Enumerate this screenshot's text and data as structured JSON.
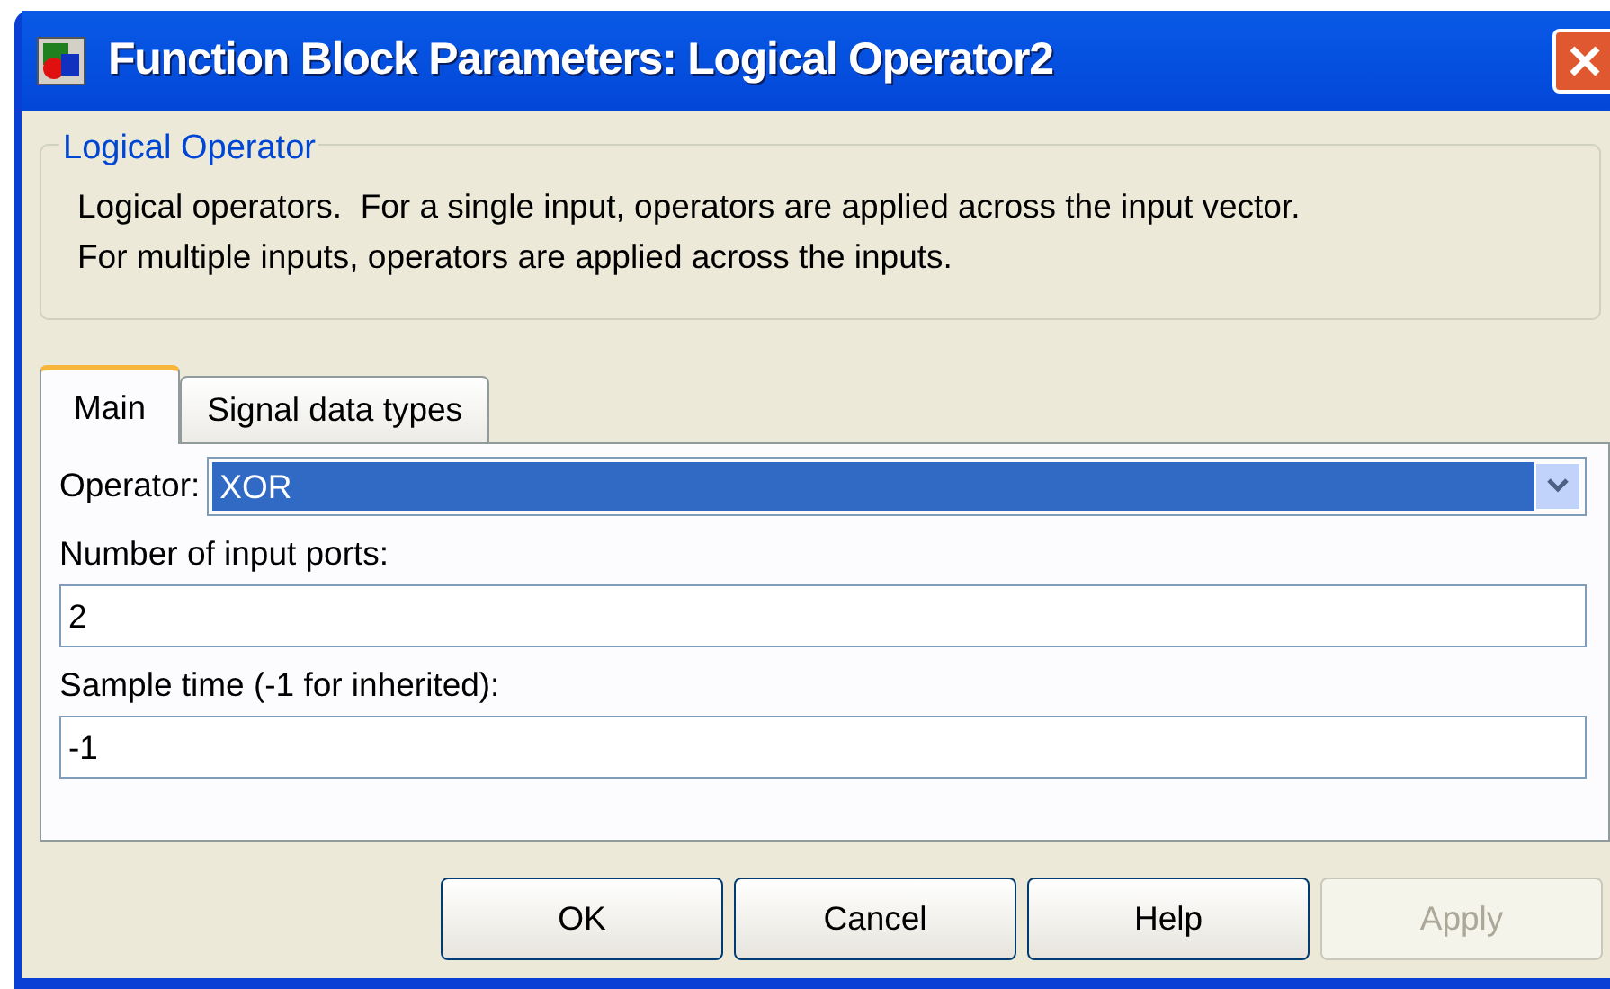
{
  "window": {
    "title": "Function Block Parameters: Logical Operator2"
  },
  "group": {
    "title": "Logical Operator",
    "description": "Logical operators.  For a single input, operators are applied across the input vector.\nFor multiple inputs, operators are applied across the inputs."
  },
  "tabs": [
    {
      "label": "Main",
      "selected": true
    },
    {
      "label": "Signal data types",
      "selected": false
    }
  ],
  "operator": {
    "label": "Operator:",
    "value": "XOR"
  },
  "fields": [
    {
      "label": "Number of input ports:",
      "value": "2"
    },
    {
      "label": "Sample time (-1 for inherited):",
      "value": "-1"
    }
  ],
  "buttons": [
    {
      "label": "OK",
      "disabled": false
    },
    {
      "label": "Cancel",
      "disabled": false
    },
    {
      "label": "Help",
      "disabled": false
    },
    {
      "label": "Apply",
      "disabled": true
    }
  ]
}
